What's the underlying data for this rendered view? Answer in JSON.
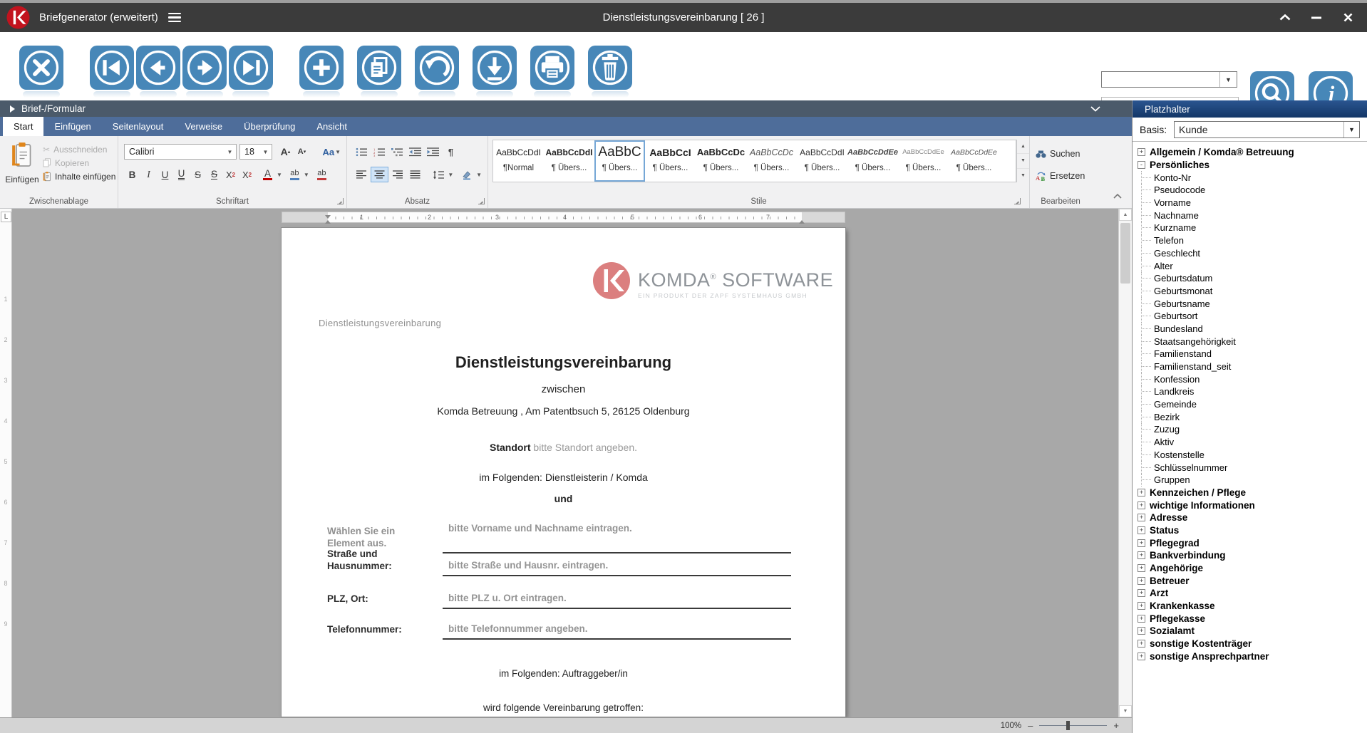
{
  "window": {
    "app_title": "Briefgenerator (erweitert)",
    "doc_title": "Dienstleistungsvereinbarung  [ 26 ]",
    "icons": [
      "app-logo-k",
      "hamburger-menu-icon",
      "collapse-window-icon",
      "minimize-icon",
      "close-icon"
    ]
  },
  "toolbar": {
    "buttons": [
      "close-record",
      "first-record",
      "previous-record",
      "next-record",
      "last-record",
      "new-record",
      "copy-record",
      "undo",
      "save-download",
      "print",
      "delete-record",
      "search",
      "info"
    ],
    "search_combo_value": "",
    "search_input_value": ""
  },
  "form_header": {
    "title": "Brief-/Formular"
  },
  "ribbon": {
    "tabs": [
      {
        "label": "Start",
        "cls": "active"
      },
      {
        "label": "Einfügen"
      },
      {
        "label": "Seitenlayout"
      },
      {
        "label": "Verweise"
      },
      {
        "label": "Überprüfung"
      },
      {
        "label": "Ansicht"
      }
    ],
    "clipboard": {
      "group": "Zwischenablage",
      "paste": "Einfügen",
      "cut": "Ausschneiden",
      "copy": "Kopieren",
      "paste_special": "Inhalte einfügen"
    },
    "font": {
      "group": "Schriftart",
      "family": "Calibri",
      "size": "18",
      "bold": "B",
      "italic": "I",
      "underline": "U",
      "dbl_underline": "U",
      "strike": "S",
      "dbl_strike": "S",
      "sup_base": "X",
      "sup_mark": "2",
      "sub_base": "X",
      "sub_mark": "2",
      "color_letter": "A",
      "highlight_label": "ab",
      "clear_label": "ab",
      "grow": "A",
      "shrink": "A",
      "case_label": "Aa"
    },
    "paragraph": {
      "group": "Absatz"
    },
    "styles": {
      "group": "Stile",
      "items": [
        {
          "sample": "AaBbCcDdI",
          "label": "¶Normal",
          "cls": "st1"
        },
        {
          "sample": "AaBbCcDdI",
          "label": "¶ Übers...",
          "cls": "st2"
        },
        {
          "sample": "AaBbC",
          "label": "¶ Übers...",
          "cls": "st3 sel"
        },
        {
          "sample": "AaBbCcI",
          "label": "¶ Übers...",
          "cls": "st4"
        },
        {
          "sample": "AaBbCcDc",
          "label": "¶ Übers...",
          "cls": "st5"
        },
        {
          "sample": "AaBbCcDc",
          "label": "¶ Übers...",
          "cls": "st6"
        },
        {
          "sample": "AaBbCcDdI",
          "label": "¶ Übers...",
          "cls": "st7"
        },
        {
          "sample": "AaBbCcDdEe",
          "label": "¶ Übers...",
          "cls": "st8"
        },
        {
          "sample": "AaBbCcDdEe",
          "label": "¶ Übers...",
          "cls": "st9"
        },
        {
          "sample": "AaBbCcDdEe",
          "label": "¶ Übers...",
          "cls": "st10"
        }
      ]
    },
    "editing": {
      "group": "Bearbeiten",
      "find": "Suchen",
      "replace": "Ersetzen"
    }
  },
  "ruler": {
    "numbers": [
      "1",
      "2",
      "3",
      "4",
      "5",
      "6",
      "7"
    ],
    "v_numbers": [
      "1",
      "2",
      "3",
      "4",
      "5",
      "6",
      "7",
      "8",
      "9"
    ],
    "tab_selector": "L"
  },
  "document": {
    "header_label": "Dienstleistungsvereinbarung",
    "logo": {
      "brand": "KOMDA",
      "reg": "®",
      "brand2": " SOFTWARE",
      "subtitle": "EIN PRODUKT DER ZAPF SYSTEMHAUS GMBH"
    },
    "title": "Dienstleistungsvereinbarung",
    "between": "zwischen",
    "address": "Komda Betreuung , Am Patentbsuch 5, 26125 Oldenburg",
    "standort_label": "Standort",
    "standort_placeholder": " bitte Standort angeben.",
    "following1": "im Folgenden: Dienstleisterin / Komda",
    "and": "und",
    "fields": [
      {
        "label": "Wählen Sie ein Element aus.",
        "placeholder": "bitte Vorname und Nachname eintragen.",
        "cls": "fr1",
        "lcls": "gray"
      },
      {
        "label": "Straße und Hausnummer:",
        "placeholder": "bitte Straße und Hausnr. eintragen.",
        "cls": "fr2"
      },
      {
        "label": "PLZ, Ort:",
        "placeholder": "bitte PLZ u. Ort eintragen.",
        "cls": "fr3"
      },
      {
        "label": "Telefonnummer:",
        "placeholder": "bitte Telefonnummer angeben.",
        "cls": "fr4"
      }
    ],
    "following2": "im Folgenden: Auftraggeber/in",
    "closing": "wird folgende Vereinbarung getroffen:"
  },
  "placeholders_panel": {
    "title": "Platzhalter",
    "basis_label": "Basis:",
    "basis_value": "Kunde",
    "tree": [
      {
        "label": "Allgemein / Komda® Betreuung",
        "cls": "root",
        "exp": "+"
      },
      {
        "label": "Persönliches",
        "cls": "root",
        "exp": "-"
      },
      {
        "label": "Konto-Nr",
        "cls": "child"
      },
      {
        "label": "Pseudocode",
        "cls": "child"
      },
      {
        "label": "Vorname",
        "cls": "child"
      },
      {
        "label": "Nachname",
        "cls": "child"
      },
      {
        "label": "Kurzname",
        "cls": "child"
      },
      {
        "label": "Telefon",
        "cls": "child"
      },
      {
        "label": "Geschlecht",
        "cls": "child"
      },
      {
        "label": "Alter",
        "cls": "child"
      },
      {
        "label": "Geburtsdatum",
        "cls": "child"
      },
      {
        "label": "Geburtsmonat",
        "cls": "child"
      },
      {
        "label": "Geburtsname",
        "cls": "child"
      },
      {
        "label": "Geburtsort",
        "cls": "child"
      },
      {
        "label": "Bundesland",
        "cls": "child"
      },
      {
        "label": "Staatsangehörigkeit",
        "cls": "child"
      },
      {
        "label": "Familienstand",
        "cls": "child"
      },
      {
        "label": "Familienstand_seit",
        "cls": "child"
      },
      {
        "label": "Konfession",
        "cls": "child"
      },
      {
        "label": "Landkreis",
        "cls": "child"
      },
      {
        "label": "Gemeinde",
        "cls": "child"
      },
      {
        "label": "Bezirk",
        "cls": "child"
      },
      {
        "label": "Zuzug",
        "cls": "child"
      },
      {
        "label": "Aktiv",
        "cls": "child"
      },
      {
        "label": "Kostenstelle",
        "cls": "child"
      },
      {
        "label": "Schlüsselnummer",
        "cls": "child"
      },
      {
        "label": "Gruppen",
        "cls": "child"
      },
      {
        "label": "Kennzeichen / Pflege",
        "cls": "root",
        "exp": "+"
      },
      {
        "label": "wichtige Informationen",
        "cls": "root",
        "exp": "+"
      },
      {
        "label": "Adresse",
        "cls": "root",
        "exp": "+"
      },
      {
        "label": "Status",
        "cls": "root",
        "exp": "+"
      },
      {
        "label": "Pflegegrad",
        "cls": "root",
        "exp": "+"
      },
      {
        "label": "Bankverbindung",
        "cls": "root",
        "exp": "+"
      },
      {
        "label": "Angehörige",
        "cls": "root",
        "exp": "+"
      },
      {
        "label": "Betreuer",
        "cls": "root",
        "exp": "+"
      },
      {
        "label": "Arzt",
        "cls": "root",
        "exp": "+"
      },
      {
        "label": "Krankenkasse",
        "cls": "root",
        "exp": "+"
      },
      {
        "label": "Pflegekasse",
        "cls": "root",
        "exp": "+"
      },
      {
        "label": "Sozialamt",
        "cls": "root",
        "exp": "+"
      },
      {
        "label": "sonstige Kostenträger",
        "cls": "root",
        "exp": "+"
      },
      {
        "label": "sonstige Ansprechpartner",
        "cls": "root",
        "exp": "+"
      }
    ]
  },
  "statusbar": {
    "zoom": "100%",
    "zoom_out": "–",
    "zoom_in": "+"
  },
  "colors": {
    "accent_blue": "#4787b8",
    "tab_blue": "#4e6d9a",
    "panel_navy": "#143767",
    "logo_red": "#c2131e",
    "doc_logo_salmon": "#db7f7f",
    "canvas_gray": "#a8a8a8"
  }
}
